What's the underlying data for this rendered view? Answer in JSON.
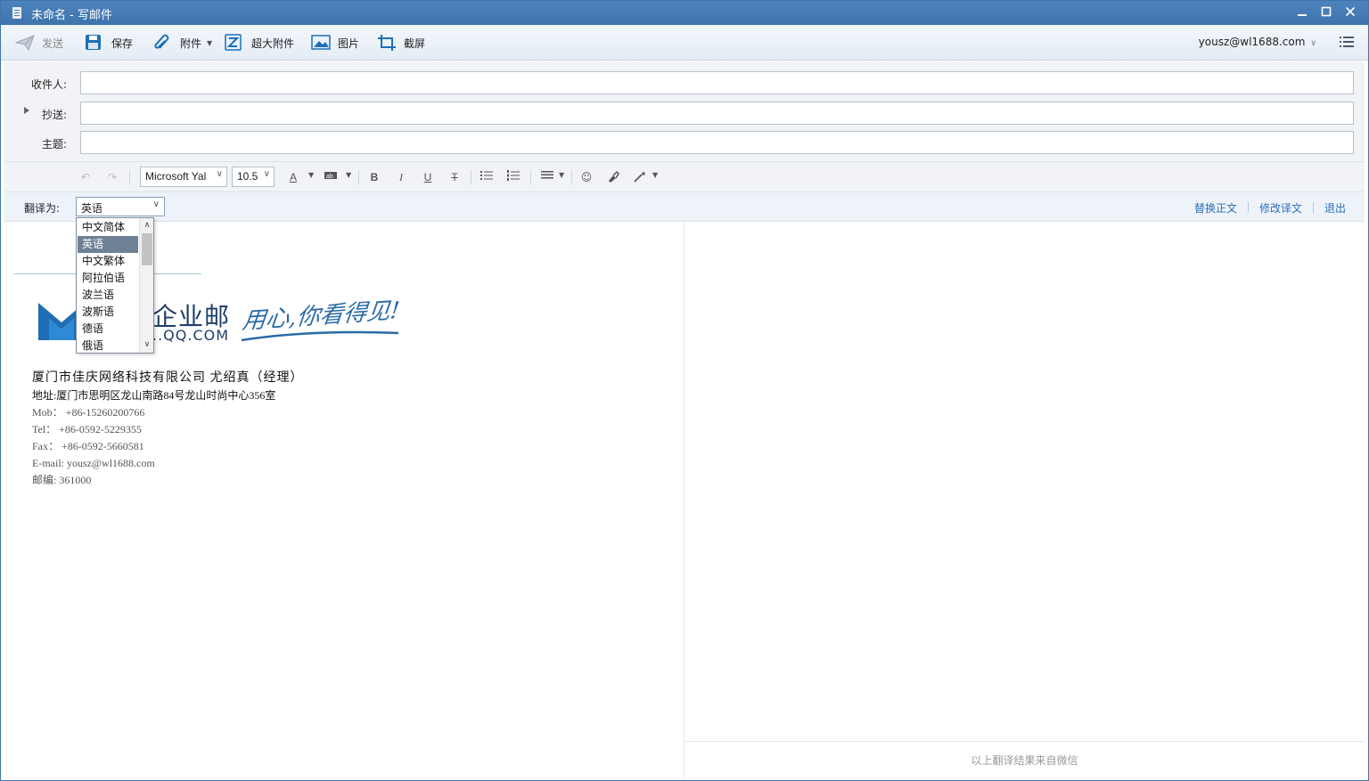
{
  "window": {
    "title": "未命名 - 写邮件",
    "controls": [
      "minimize",
      "maximize",
      "close"
    ]
  },
  "toolbar": {
    "send_label": "发送",
    "save_label": "保存",
    "attach_label": "附件",
    "large_attach_label": "超大附件",
    "image_label": "图片",
    "screenshot_label": "截屏",
    "account": "yousz@wl1688.com"
  },
  "fields": {
    "to_label": "收件人:",
    "cc_label": "抄送:",
    "subject_label": "主题:",
    "to_value": "",
    "cc_value": "",
    "subject_value": ""
  },
  "format": {
    "font_name": "Microsoft Yal",
    "font_size": "10.5",
    "buttons": [
      "undo",
      "redo",
      "font-color",
      "highlight",
      "bold",
      "italic",
      "underline",
      "strikethrough",
      "bullet-list",
      "numbered-list",
      "align",
      "emoji",
      "format-painter",
      "magic"
    ]
  },
  "translate": {
    "label": "翻译为:",
    "selected": "英语",
    "replace_label": "替换正文",
    "edit_label": "修改译文",
    "exit_label": "退出",
    "options": [
      "中文简体",
      "英语",
      "中文繁体",
      "阿拉伯语",
      "波兰语",
      "波斯语",
      "德语",
      "俄语"
    ],
    "footer_note": "以上翻译结果来自微信"
  },
  "logo": {
    "cn": "企业邮",
    "en": "..QQ.COM",
    "slogan": "用心,你看得见!"
  },
  "signature": {
    "company": "厦门市佳庆网络科技有限公司 尤绍真（经理）",
    "address": "地址:厦门市思明区龙山南路84号龙山时尚中心356室",
    "mob": "Mob：  +86-15260200766",
    "tel": "Tel：    +86-0592-5229355",
    "fax": "Fax：   +86-0592-5660581",
    "email": "E-mail: yousz@wl1688.com",
    "zip": "邮编: 361000"
  },
  "colors": {
    "titlebar": "#4d83bd",
    "link": "#2a6db5",
    "selected_option": "#6f8196",
    "logo_navy": "#1f3e69"
  }
}
